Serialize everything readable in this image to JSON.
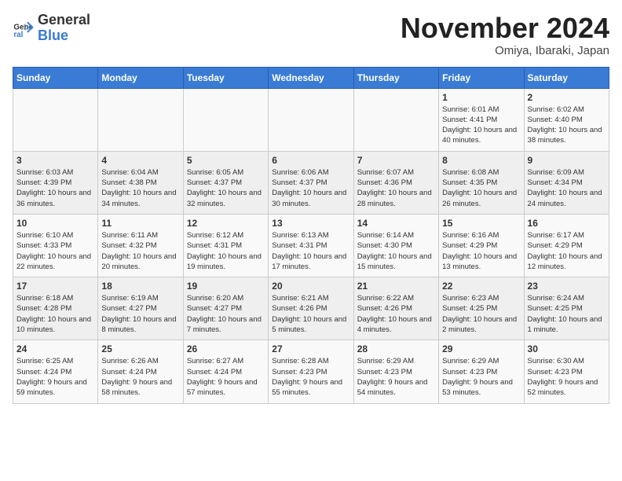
{
  "header": {
    "logo_general": "General",
    "logo_blue": "Blue",
    "month_title": "November 2024",
    "location": "Omiya, Ibaraki, Japan"
  },
  "days_of_week": [
    "Sunday",
    "Monday",
    "Tuesday",
    "Wednesday",
    "Thursday",
    "Friday",
    "Saturday"
  ],
  "weeks": [
    [
      {
        "day": "",
        "info": ""
      },
      {
        "day": "",
        "info": ""
      },
      {
        "day": "",
        "info": ""
      },
      {
        "day": "",
        "info": ""
      },
      {
        "day": "",
        "info": ""
      },
      {
        "day": "1",
        "info": "Sunrise: 6:01 AM\nSunset: 4:41 PM\nDaylight: 10 hours and 40 minutes."
      },
      {
        "day": "2",
        "info": "Sunrise: 6:02 AM\nSunset: 4:40 PM\nDaylight: 10 hours and 38 minutes."
      }
    ],
    [
      {
        "day": "3",
        "info": "Sunrise: 6:03 AM\nSunset: 4:39 PM\nDaylight: 10 hours and 36 minutes."
      },
      {
        "day": "4",
        "info": "Sunrise: 6:04 AM\nSunset: 4:38 PM\nDaylight: 10 hours and 34 minutes."
      },
      {
        "day": "5",
        "info": "Sunrise: 6:05 AM\nSunset: 4:37 PM\nDaylight: 10 hours and 32 minutes."
      },
      {
        "day": "6",
        "info": "Sunrise: 6:06 AM\nSunset: 4:37 PM\nDaylight: 10 hours and 30 minutes."
      },
      {
        "day": "7",
        "info": "Sunrise: 6:07 AM\nSunset: 4:36 PM\nDaylight: 10 hours and 28 minutes."
      },
      {
        "day": "8",
        "info": "Sunrise: 6:08 AM\nSunset: 4:35 PM\nDaylight: 10 hours and 26 minutes."
      },
      {
        "day": "9",
        "info": "Sunrise: 6:09 AM\nSunset: 4:34 PM\nDaylight: 10 hours and 24 minutes."
      }
    ],
    [
      {
        "day": "10",
        "info": "Sunrise: 6:10 AM\nSunset: 4:33 PM\nDaylight: 10 hours and 22 minutes."
      },
      {
        "day": "11",
        "info": "Sunrise: 6:11 AM\nSunset: 4:32 PM\nDaylight: 10 hours and 20 minutes."
      },
      {
        "day": "12",
        "info": "Sunrise: 6:12 AM\nSunset: 4:31 PM\nDaylight: 10 hours and 19 minutes."
      },
      {
        "day": "13",
        "info": "Sunrise: 6:13 AM\nSunset: 4:31 PM\nDaylight: 10 hours and 17 minutes."
      },
      {
        "day": "14",
        "info": "Sunrise: 6:14 AM\nSunset: 4:30 PM\nDaylight: 10 hours and 15 minutes."
      },
      {
        "day": "15",
        "info": "Sunrise: 6:16 AM\nSunset: 4:29 PM\nDaylight: 10 hours and 13 minutes."
      },
      {
        "day": "16",
        "info": "Sunrise: 6:17 AM\nSunset: 4:29 PM\nDaylight: 10 hours and 12 minutes."
      }
    ],
    [
      {
        "day": "17",
        "info": "Sunrise: 6:18 AM\nSunset: 4:28 PM\nDaylight: 10 hours and 10 minutes."
      },
      {
        "day": "18",
        "info": "Sunrise: 6:19 AM\nSunset: 4:27 PM\nDaylight: 10 hours and 8 minutes."
      },
      {
        "day": "19",
        "info": "Sunrise: 6:20 AM\nSunset: 4:27 PM\nDaylight: 10 hours and 7 minutes."
      },
      {
        "day": "20",
        "info": "Sunrise: 6:21 AM\nSunset: 4:26 PM\nDaylight: 10 hours and 5 minutes."
      },
      {
        "day": "21",
        "info": "Sunrise: 6:22 AM\nSunset: 4:26 PM\nDaylight: 10 hours and 4 minutes."
      },
      {
        "day": "22",
        "info": "Sunrise: 6:23 AM\nSunset: 4:25 PM\nDaylight: 10 hours and 2 minutes."
      },
      {
        "day": "23",
        "info": "Sunrise: 6:24 AM\nSunset: 4:25 PM\nDaylight: 10 hours and 1 minute."
      }
    ],
    [
      {
        "day": "24",
        "info": "Sunrise: 6:25 AM\nSunset: 4:24 PM\nDaylight: 9 hours and 59 minutes."
      },
      {
        "day": "25",
        "info": "Sunrise: 6:26 AM\nSunset: 4:24 PM\nDaylight: 9 hours and 58 minutes."
      },
      {
        "day": "26",
        "info": "Sunrise: 6:27 AM\nSunset: 4:24 PM\nDaylight: 9 hours and 57 minutes."
      },
      {
        "day": "27",
        "info": "Sunrise: 6:28 AM\nSunset: 4:23 PM\nDaylight: 9 hours and 55 minutes."
      },
      {
        "day": "28",
        "info": "Sunrise: 6:29 AM\nSunset: 4:23 PM\nDaylight: 9 hours and 54 minutes."
      },
      {
        "day": "29",
        "info": "Sunrise: 6:29 AM\nSunset: 4:23 PM\nDaylight: 9 hours and 53 minutes."
      },
      {
        "day": "30",
        "info": "Sunrise: 6:30 AM\nSunset: 4:23 PM\nDaylight: 9 hours and 52 minutes."
      }
    ]
  ]
}
